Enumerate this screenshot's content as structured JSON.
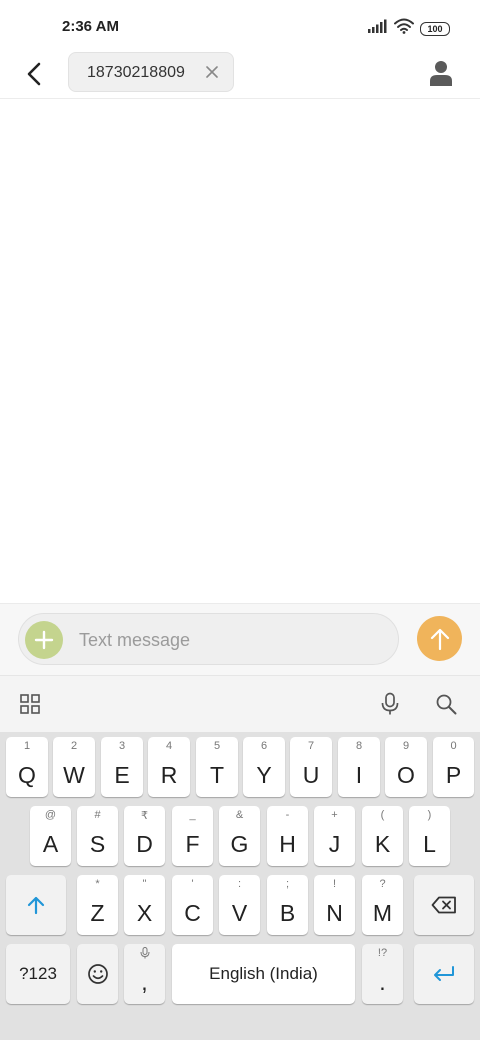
{
  "status_bar": {
    "time": "2:36 AM",
    "battery": "100"
  },
  "header": {
    "recipient": "18730218809"
  },
  "compose": {
    "placeholder": "Text message"
  },
  "keyboard": {
    "row1": [
      {
        "hint": "1",
        "key": "Q"
      },
      {
        "hint": "2",
        "key": "W"
      },
      {
        "hint": "3",
        "key": "E"
      },
      {
        "hint": "4",
        "key": "R"
      },
      {
        "hint": "5",
        "key": "T"
      },
      {
        "hint": "6",
        "key": "Y"
      },
      {
        "hint": "7",
        "key": "U"
      },
      {
        "hint": "8",
        "key": "I"
      },
      {
        "hint": "9",
        "key": "O"
      },
      {
        "hint": "0",
        "key": "P"
      }
    ],
    "row2": [
      {
        "hint": "@",
        "key": "A"
      },
      {
        "hint": "#",
        "key": "S"
      },
      {
        "hint": "₹",
        "key": "D"
      },
      {
        "hint": "_",
        "key": "F"
      },
      {
        "hint": "&",
        "key": "G"
      },
      {
        "hint": "-",
        "key": "H"
      },
      {
        "hint": "+",
        "key": "J"
      },
      {
        "hint": "(",
        "key": "K"
      },
      {
        "hint": ")",
        "key": "L"
      }
    ],
    "row3": [
      {
        "hint": "*",
        "key": "Z"
      },
      {
        "hint": "\"",
        "key": "X"
      },
      {
        "hint": "'",
        "key": "C"
      },
      {
        "hint": ":",
        "key": "V"
      },
      {
        "hint": ";",
        "key": "B"
      },
      {
        "hint": "!",
        "key": "N"
      },
      {
        "hint": "?",
        "key": "M"
      }
    ],
    "symbols_label": "?123",
    "comma": ",",
    "space_label": "English (India)",
    "period_hint": "!?",
    "period": ".",
    "colors": {
      "accent": "#2196d8",
      "key_bg": "#ffffff",
      "board_bg": "#e1e1e1"
    }
  }
}
